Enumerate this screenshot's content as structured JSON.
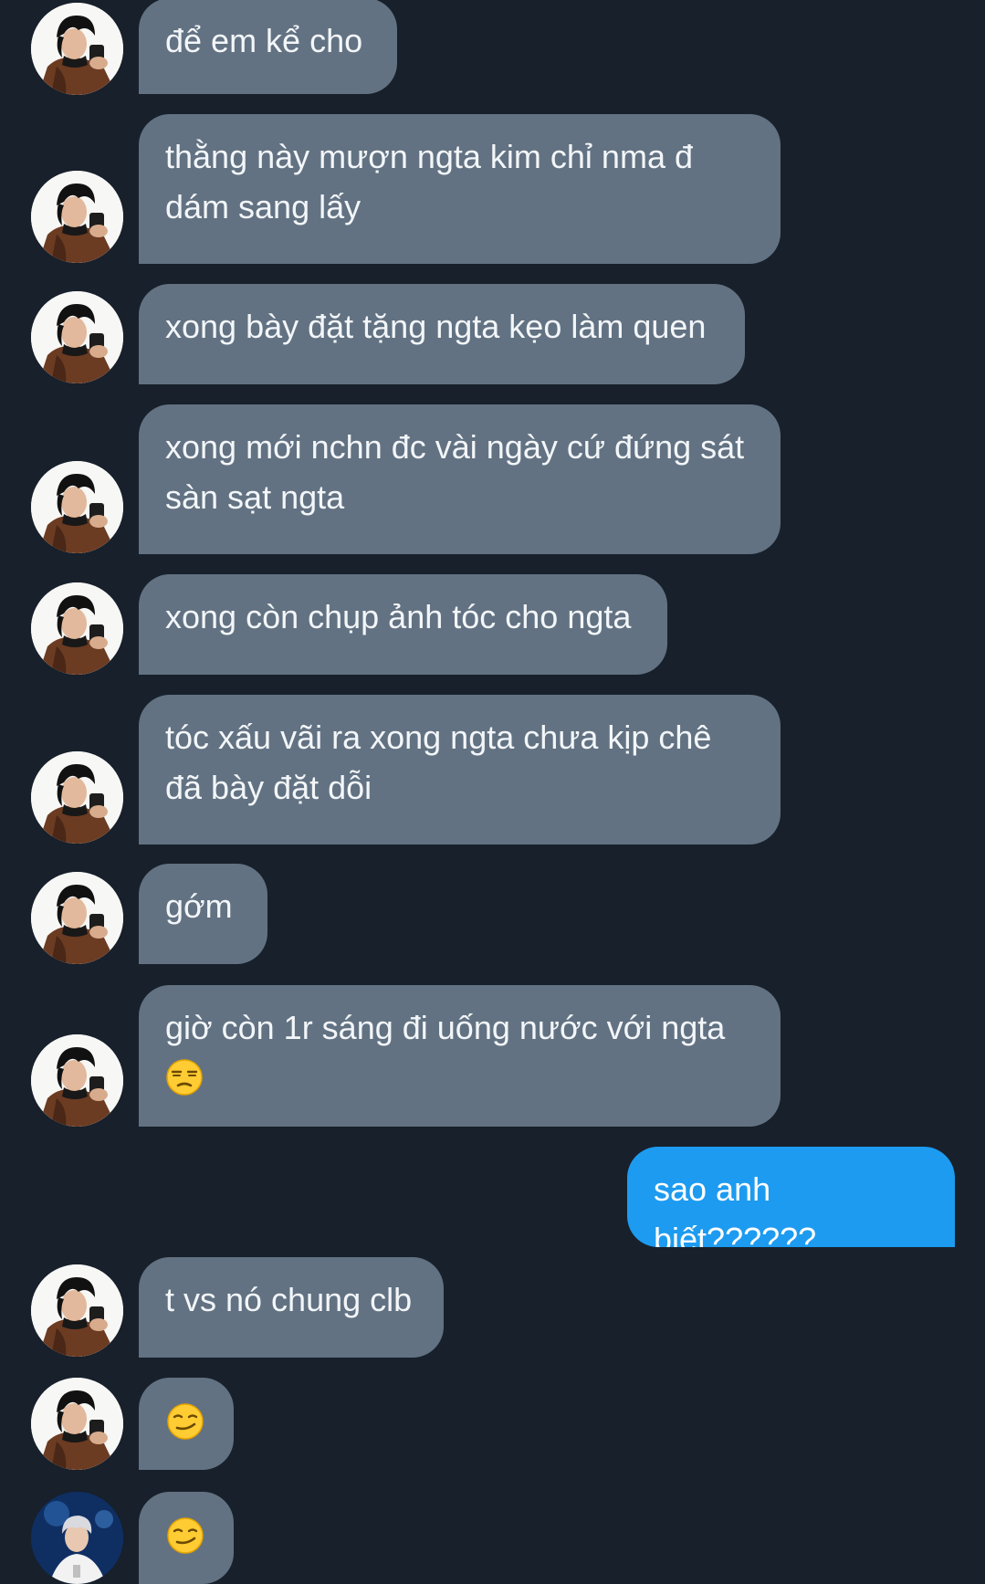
{
  "colors": {
    "background": "#17202b",
    "incoming_bubble": "#627282",
    "outgoing_bubble": "#1d9bf0",
    "text": "#f3f6f9"
  },
  "messages": [
    {
      "sender": "other",
      "text": "để em kể cho"
    },
    {
      "sender": "other",
      "text": "thằng này mượn ngta kim chỉ nma đ dám sang lấy"
    },
    {
      "sender": "other",
      "text": "xong bày đặt tặng ngta kẹo làm quen"
    },
    {
      "sender": "other",
      "text": "xong mới nchn đc vài ngày cứ đứng sát sàn sạt ngta"
    },
    {
      "sender": "other",
      "text": "xong còn chụp ảnh tóc cho ngta"
    },
    {
      "sender": "other",
      "text": "tóc xấu vãi ra xong ngta chưa kịp chê đã bày đặt dỗi"
    },
    {
      "sender": "other",
      "text": "gớm"
    },
    {
      "sender": "other",
      "text": "giờ còn 1r sáng đi uống nước với ngta",
      "emoji": "unamused-face-icon"
    },
    {
      "sender": "me",
      "text": "sao anh biết??????"
    },
    {
      "sender": "other",
      "text": "t vs nó chung clb"
    },
    {
      "sender": "other",
      "emoji": "smirking-face-icon"
    },
    {
      "sender": "me_with_avatar",
      "emoji": "smirking-face-icon"
    }
  ]
}
